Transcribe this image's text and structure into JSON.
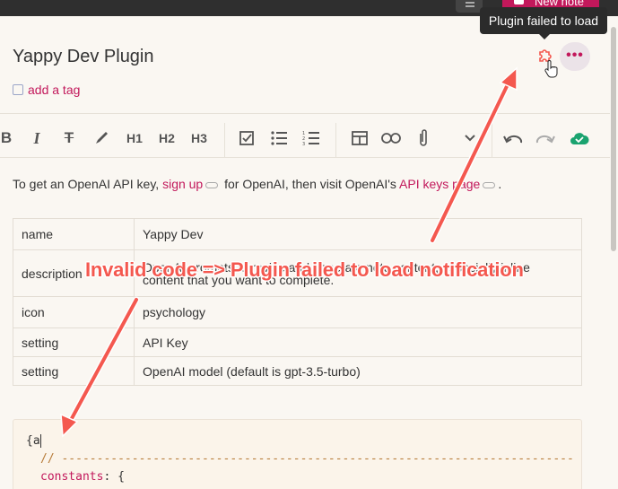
{
  "topbar": {
    "new_note_label": "New note"
  },
  "tooltip": {
    "text": "Plugin failed to load"
  },
  "note": {
    "title": "Yappy Dev Plugin",
    "add_tag": "add a tag"
  },
  "toolbar": {
    "items": [
      "bold-icon",
      "italic-icon",
      "strikethrough-icon",
      "highlight-brush-icon",
      "H1",
      "H2",
      "H3",
      "checklist-icon",
      "bullet-list-icon",
      "numbered-list-icon",
      "table-icon",
      "link-icon",
      "attachment-icon",
      "chevron-down-icon",
      "undo-icon",
      "redo-icon",
      "synced-cloud-icon"
    ]
  },
  "paragraph": {
    "prefix": "To get an OpenAI API key,",
    "link1": "sign up",
    "middle": "for OpenAI, then visit OpenAI's",
    "link2": "API keys page",
    "suffix": "."
  },
  "table": {
    "rows": [
      {
        "key": "name",
        "value": "Yappy Dev"
      },
      {
        "key": "description",
        "value": "OpenAI prompts to revise and generate note content, especially inline content that you want to complete."
      },
      {
        "key": "icon",
        "value": "psychology"
      },
      {
        "key": "setting",
        "value": "API Key"
      },
      {
        "key": "setting",
        "value": "OpenAI model (default is gpt-3.5-turbo)"
      }
    ]
  },
  "code": {
    "line1": "{a",
    "line2": "// -----------------------------------------------------------------------------------",
    "line3_key": "constants",
    "line3_rest": ": {"
  },
  "annotation": {
    "text": "Invalid code => Plugin failed to load notification"
  },
  "colors": {
    "accent": "#c2185b",
    "annotation_red": "#f4584f"
  }
}
